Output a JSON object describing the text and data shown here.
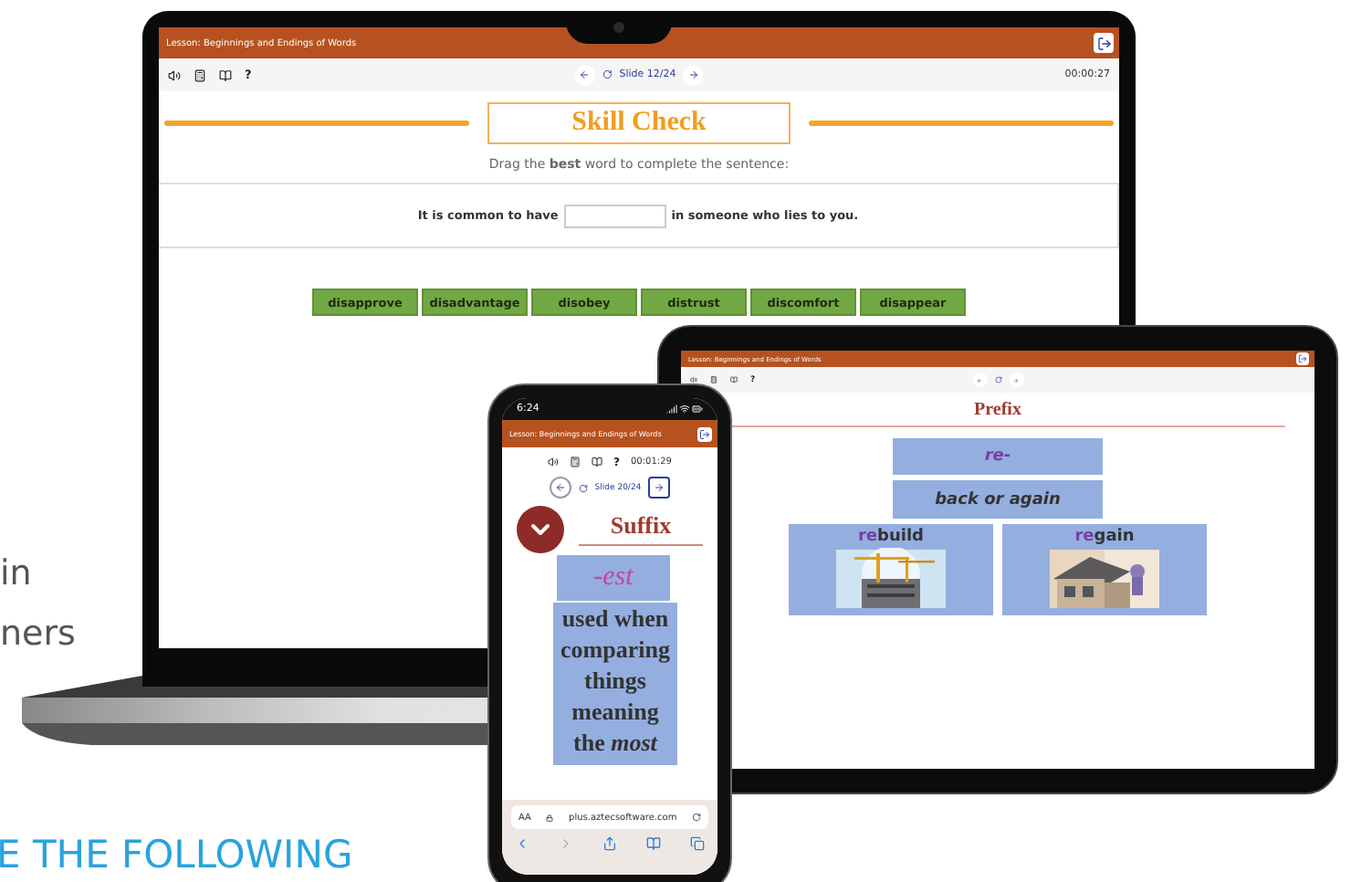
{
  "marketing_text": {
    "lines": [
      "in",
      "ners"
    ],
    "heading": "E THE FOLLOWING"
  },
  "laptop": {
    "lesson_title": "Lesson: Beginnings and Endings of Words",
    "help": "?",
    "slide": "Slide 12/24",
    "timer": "00:00:27",
    "title": "Skill Check",
    "instruction": "Drag the **best** word to complete the sentence:",
    "sentence_before": "It is common to have",
    "sentence_after": "in someone who lies to you.",
    "words": [
      "disapprove",
      "disadvantage",
      "disobey",
      "distrust",
      "discomfort",
      "disappear"
    ]
  },
  "tablet": {
    "lesson_title": "Lesson: Beginnings and Endings of Words",
    "help": "?",
    "title": "Prefix",
    "prefix": "re-",
    "meaning": "back or again",
    "examples": [
      {
        "prefix": "re",
        "rest": "build",
        "kind": "picture"
      },
      {
        "prefix": "re",
        "rest": "gain",
        "kind": "picture"
      }
    ]
  },
  "phone": {
    "status_time": "6:24",
    "lesson_title": "Lesson: Beginnings and Endings of Words",
    "help": "?",
    "timer": "00:01:29",
    "slide": "Slide 20/24",
    "title": "Suffix",
    "suffix": "-est",
    "definition": "used when comparing things meaning the *most*",
    "text_size": "AA",
    "address": "plus.aztecsoftware.com"
  }
}
